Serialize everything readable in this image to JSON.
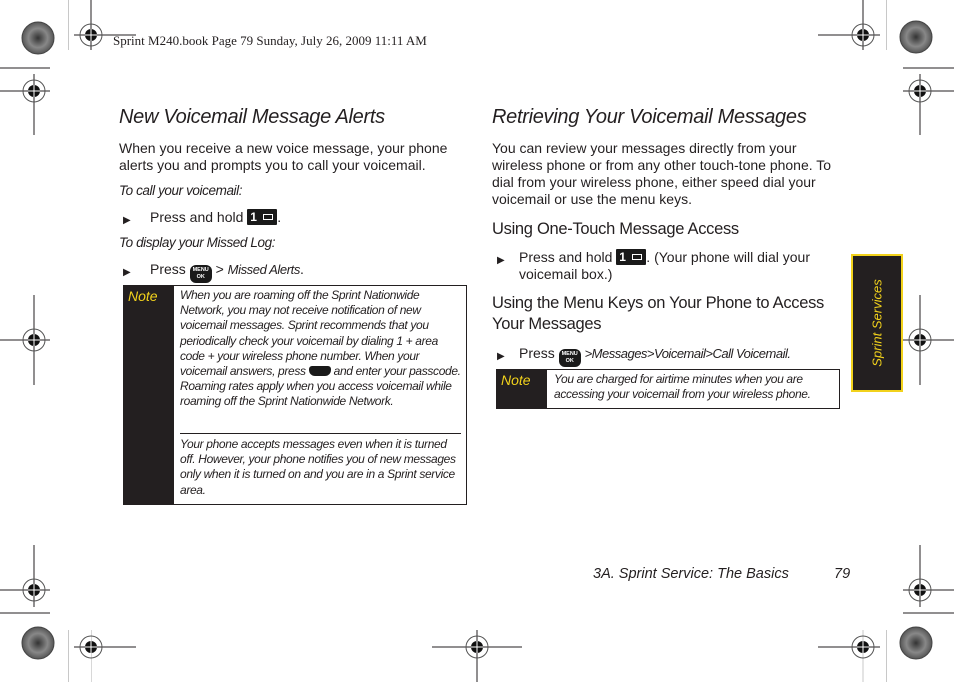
{
  "print_header": "Sprint M240.book  Page 79  Sunday, July 26, 2009  11:11 AM",
  "left_column": {
    "title": "New Voicemail Message Alerts",
    "intro": "When you receive a new voice message, your phone alerts you and prompts you to call your voicemail.",
    "call_lead": "To call your voicemail:",
    "call_step": {
      "prefix": "Press and hold",
      "key_icon": "key-1-voicemail-icon",
      "suffix": "."
    },
    "missed_lead": "To display your Missed Log:",
    "missed_step": {
      "prefix": "Press",
      "key_icon": "menu-ok-key-icon",
      "sep": " > ",
      "path": "Missed Alerts",
      "suffix": "."
    },
    "note": {
      "label": "Note",
      "para1_a": "When you are roaming off the Sprint Nationwide Network, you may not receive notification of new voicemail messages. Sprint recommends that you periodically check your voicemail by dialing 1 + area code + your wireless phone number. When your voicemail answers, press",
      "para1_key": "star-shift-key-icon",
      "para1_b": "and enter your passcode. Roaming rates apply when you access voicemail while roaming off the Sprint Nationwide Network.",
      "para2": "Your phone accepts messages even when it is turned off. However, your phone notifies you of new messages only when it is turned on and you are in a Sprint service area."
    }
  },
  "right_column": {
    "title": "Retrieving Your Voicemail Messages",
    "intro": "You can review your messages directly from your wireless phone or from any other touch-tone phone. To dial from your wireless phone, either speed dial your voicemail or use the menu keys.",
    "subsection1": {
      "title": "Using One-Touch Message Access",
      "step_prefix": "Press and hold",
      "step_suffix_line1": ". (Your phone will dial your",
      "step_suffix_line2": "voicemail box.)"
    },
    "subsection2": {
      "title_line1": "Using the Menu Keys on Your Phone to Access",
      "title_line2": "Your Messages",
      "step_prefix": "Press",
      "path": [
        ">",
        "Messages",
        ">",
        "Voicemail",
        ">",
        "Call Voicemail."
      ]
    },
    "note": {
      "label": "Note",
      "text": "You are charged for airtime minutes when you are accessing your voicemail from your wireless phone."
    }
  },
  "side_tab": {
    "label": "Sprint Services"
  },
  "footer": {
    "section": "3A. Sprint Service: The Basics",
    "page_number": "79"
  },
  "colors": {
    "accent_yellow": "#f2d21c",
    "dark": "#231f20"
  }
}
